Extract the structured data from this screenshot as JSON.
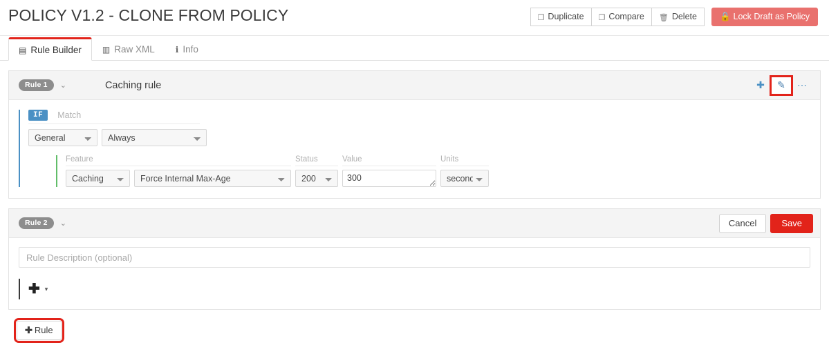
{
  "header": {
    "title": "POLICY V1.2 - CLONE FROM POLICY",
    "actions": [
      {
        "label": "Duplicate",
        "icon": "copy-icon",
        "glyph": "❐"
      },
      {
        "label": "Compare",
        "icon": "compare-icon",
        "glyph": "❐"
      },
      {
        "label": "Delete",
        "icon": "trash-icon",
        "glyph": "🗑"
      }
    ],
    "lock_button": {
      "label": "Lock Draft as Policy",
      "icon": "lock-icon",
      "glyph": "🔒",
      "color": "#e9716e"
    }
  },
  "tabs": [
    {
      "label": "Rule Builder",
      "icon": "window-icon",
      "glyph": "▤",
      "active": true
    },
    {
      "label": "Raw XML",
      "icon": "file-code-icon",
      "glyph": "▥",
      "active": false
    },
    {
      "label": "Info",
      "icon": "info-circle-icon",
      "glyph": "ℹ",
      "active": false
    }
  ],
  "accent": {
    "active_tab": "#e2231a",
    "if_badge": "#4a90c4",
    "feature_bar": "#62bd69",
    "save": "#e2231a",
    "highlight": "#e2231a"
  },
  "rule1": {
    "badge": "Rule 1",
    "name": "Caching rule",
    "caret": "⌄",
    "actions": [
      {
        "name": "add-icon",
        "glyph": "✚",
        "highlighted": false
      },
      {
        "name": "edit-pencil-icon",
        "glyph": "✎",
        "highlighted": true
      },
      {
        "name": "more-options-icon",
        "glyph": "⋯",
        "highlighted": false
      }
    ],
    "condition": {
      "if_badge": "IF",
      "match_label": "Match",
      "scope": "General",
      "operator": "Always"
    },
    "action_fields": {
      "labels": {
        "feature": "Feature",
        "status": "Status",
        "value": "Value",
        "units": "Units"
      },
      "feature": "Caching",
      "feature_detail": "Force Internal Max-Age",
      "status": "200",
      "value": "300",
      "units": "seconds"
    }
  },
  "rule2": {
    "badge": "Rule 2",
    "caret": "⌄",
    "cancel_label": "Cancel",
    "save_label": "Save",
    "description_placeholder": "Rule Description (optional)",
    "description_value": "",
    "add_plus": "✚",
    "add_caret": "▾"
  },
  "add_rule_button": {
    "plus": "✚",
    "label": "Rule"
  }
}
